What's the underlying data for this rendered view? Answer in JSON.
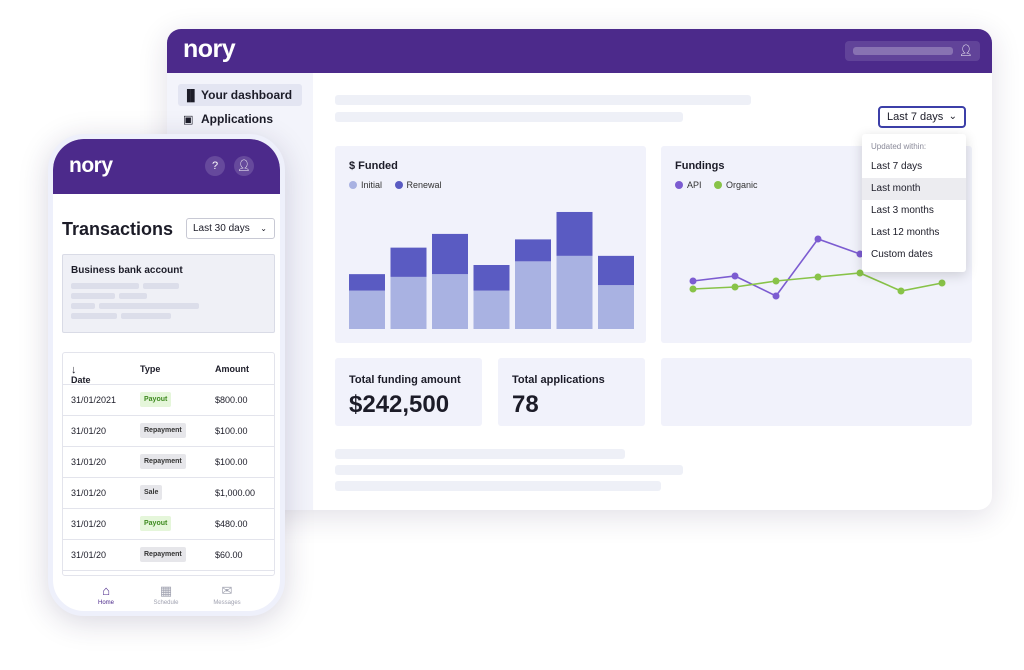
{
  "desktop": {
    "logo": "nory",
    "sidebar": [
      {
        "label": "Your dashboard",
        "icon": "bar-chart-icon",
        "active": true
      },
      {
        "label": "Applications",
        "icon": "applications-icon",
        "active": false
      }
    ],
    "range_button": "Last 7 days",
    "dropdown": {
      "heading": "Updated within:",
      "options": [
        "Last 7 days",
        "Last month",
        "Last 3 months",
        "Last 12 months",
        "Custom dates"
      ],
      "highlighted": "Last month"
    },
    "funded_panel": {
      "title": "$ Funded",
      "legend": [
        "Initial",
        "Renewal"
      ]
    },
    "fundings_panel": {
      "title": "Fundings",
      "legend": [
        "API",
        "Organic"
      ]
    },
    "stats": [
      {
        "label": "Total funding amount",
        "value": "$242,500"
      },
      {
        "label": "Total applications",
        "value": "78"
      }
    ]
  },
  "chart_data": [
    {
      "type": "bar",
      "title": "$ Funded",
      "stacked": true,
      "categories": [
        "1",
        "2",
        "3",
        "4",
        "5",
        "6",
        "7"
      ],
      "series": [
        {
          "name": "Initial",
          "values": [
            42,
            57,
            60,
            42,
            74,
            80,
            48
          ]
        },
        {
          "name": "Renewal",
          "values": [
            18,
            32,
            44,
            28,
            24,
            48,
            32
          ]
        }
      ],
      "ylim": [
        0,
        140
      ],
      "colors": {
        "Initial": "#a9b2e2",
        "Renewal": "#5a5bc2"
      }
    },
    {
      "type": "line",
      "title": "Fundings",
      "x": [
        1,
        2,
        3,
        4,
        5,
        6,
        7
      ],
      "series": [
        {
          "name": "API",
          "values": [
            30,
            35,
            15,
            72,
            57,
            null,
            null
          ]
        },
        {
          "name": "Organic",
          "values": [
            22,
            24,
            30,
            34,
            38,
            20,
            28
          ]
        }
      ],
      "ylim": [
        0,
        100
      ],
      "colors": {
        "API": "#7c5cd1",
        "Organic": "#88c348"
      }
    }
  ],
  "colors": {
    "brand": "#4c2a8b",
    "accent": "#3c3fa8",
    "payout_bg": "#e5f6da",
    "payout_text": "#3d8a1e",
    "neutral_tag": "#e6e6ea"
  },
  "phone": {
    "logo": "nory",
    "title": "Transactions",
    "range": "Last 30 days",
    "account_title": "Business bank account",
    "table": {
      "headers": [
        "Date",
        "Type",
        "Amount"
      ],
      "rows": [
        {
          "date": "31/01/2021",
          "type": "Payout",
          "amount": "$800.00"
        },
        {
          "date": "31/01/20",
          "type": "Repayment",
          "amount": "$100.00"
        },
        {
          "date": "31/01/20",
          "type": "Repayment",
          "amount": "$100.00"
        },
        {
          "date": "31/01/20",
          "type": "Sale",
          "amount": "$1,000.00"
        },
        {
          "date": "31/01/20",
          "type": "Payout",
          "amount": "$480.00"
        },
        {
          "date": "31/01/20",
          "type": "Repayment",
          "amount": "$60.00"
        }
      ]
    },
    "nav": [
      {
        "label": "Home",
        "icon": "home-icon",
        "active": true
      },
      {
        "label": "Schedule",
        "icon": "calendar-icon",
        "active": false
      },
      {
        "label": "Messages",
        "icon": "messages-icon",
        "active": false
      }
    ]
  }
}
